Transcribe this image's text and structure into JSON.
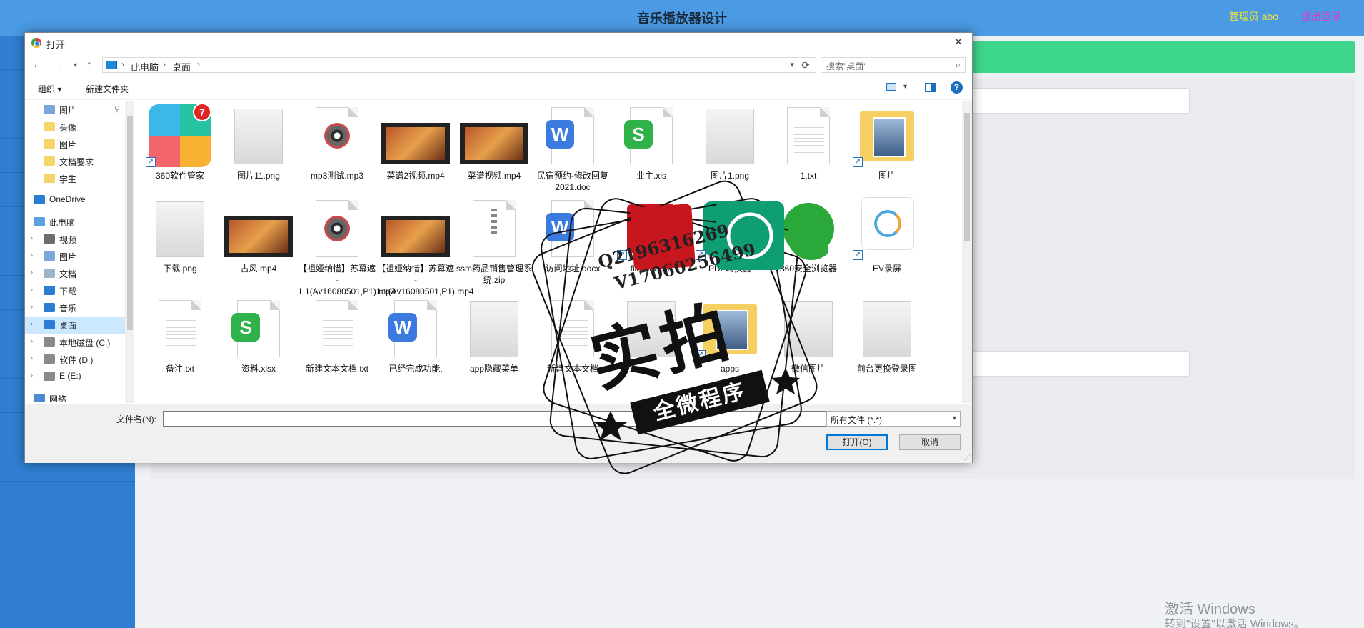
{
  "app": {
    "title": "音乐播放器设计",
    "user": "管理员 abo",
    "logout": "退出登录",
    "sidebar_items": [
      "home",
      "user",
      "list",
      "chat",
      "music",
      "comment",
      "mail",
      "mail",
      "mail",
      "book",
      "location",
      "message",
      "inbox"
    ],
    "windows_activate": "激活 Windows",
    "windows_activate_sub": "转到\"设置\"以激活 Windows。",
    "colors": {
      "header": "#4a9be3",
      "sidebar": "#2f7ed1",
      "green_bar": "#3ed68d",
      "user": "#f2e33a",
      "logout": "#d83fc6"
    }
  },
  "dialog": {
    "title": "打开",
    "breadcrumb": [
      "此电脑",
      "桌面"
    ],
    "search_placeholder": "搜索\"桌面\"",
    "toolbar": {
      "organize": "组织 ▾",
      "new_folder": "新建文件夹"
    },
    "tree": [
      {
        "label": "图片",
        "pinned": true,
        "icon": "pictures-icon"
      },
      {
        "label": "头像",
        "icon": "folder-icon"
      },
      {
        "label": "图片",
        "icon": "folder-icon"
      },
      {
        "label": "文档要求",
        "icon": "folder-icon"
      },
      {
        "label": "学生",
        "icon": "folder-icon"
      },
      {
        "label": "OneDrive",
        "icon": "cloud-icon"
      },
      {
        "label": "此电脑",
        "icon": "computer-icon"
      },
      {
        "label": "视频",
        "icon": "video-icon"
      },
      {
        "label": "图片",
        "icon": "pictures-icon"
      },
      {
        "label": "文档",
        "icon": "documents-icon"
      },
      {
        "label": "下载",
        "icon": "download-icon"
      },
      {
        "label": "音乐",
        "icon": "music-icon"
      },
      {
        "label": "桌面",
        "icon": "desktop-icon",
        "selected": true
      },
      {
        "label": "本地磁盘 (C:)",
        "icon": "drive-icon"
      },
      {
        "label": "软件 (D:)",
        "icon": "drive-icon"
      },
      {
        "label": "E (E:)",
        "icon": "drive-icon"
      },
      {
        "label": "网络",
        "icon": "network-icon"
      }
    ],
    "files": [
      {
        "label": "360软件管家",
        "kind": "app360",
        "badge": "7"
      },
      {
        "label": "图片11.png",
        "kind": "image"
      },
      {
        "label": "mp3测试.mp3",
        "kind": "audio"
      },
      {
        "label": "菜谱2视频.mp4",
        "kind": "video"
      },
      {
        "label": "菜谱视频.mp4",
        "kind": "video"
      },
      {
        "label": "民宿预约-修改回复2021.doc",
        "kind": "word"
      },
      {
        "label": "业主.xls",
        "kind": "excel"
      },
      {
        "label": "图片1.png",
        "kind": "image"
      },
      {
        "label": "1.txt",
        "kind": "text"
      },
      {
        "label": "图片",
        "kind": "folder"
      },
      {
        "label": "下载.png",
        "kind": "image"
      },
      {
        "label": "古风.mp4",
        "kind": "video"
      },
      {
        "label": "【祖娅纳惜】苏幕遮 - 1.1(Av16080501,P1).mp3",
        "kind": "audio"
      },
      {
        "label": "【祖娅纳惜】苏幕遮 - 1.1(Av16080501,P1).mp4",
        "kind": "video"
      },
      {
        "label": "ssm药品销售管理系统.zip",
        "kind": "zip"
      },
      {
        "label": "访问地址.docx",
        "kind": "word"
      },
      {
        "label": "filezilla.exe",
        "kind": "app"
      },
      {
        "label": "PDF转换器",
        "kind": "pdf"
      },
      {
        "label": "360安全浏览器",
        "kind": "browser"
      },
      {
        "label": "EV录屏",
        "kind": "ev"
      },
      {
        "label": "备注.txt",
        "kind": "text"
      },
      {
        "label": "资料.xlsx",
        "kind": "excel"
      },
      {
        "label": "新建文本文档.txt",
        "kind": "text"
      },
      {
        "label": "已经完成功能.",
        "kind": "word"
      },
      {
        "label": "app隐藏菜单",
        "kind": "image"
      },
      {
        "label": "新建文本文档",
        "kind": "text"
      },
      {
        "label": "",
        "kind": "image"
      },
      {
        "label": "apps",
        "kind": "folder"
      },
      {
        "label": "微信图片",
        "kind": "image"
      },
      {
        "label": "前台更换登录图",
        "kind": "image"
      }
    ],
    "filename_label": "文件名(N):",
    "filename_value": "",
    "filetype": "所有文件 (*.*)",
    "open_button": "打开(O)",
    "cancel_button": "取消"
  },
  "watermark": {
    "line1": "Q2196316269",
    "line2": "V17060256499",
    "main": "实拍",
    "ribbon": "全微程序"
  }
}
